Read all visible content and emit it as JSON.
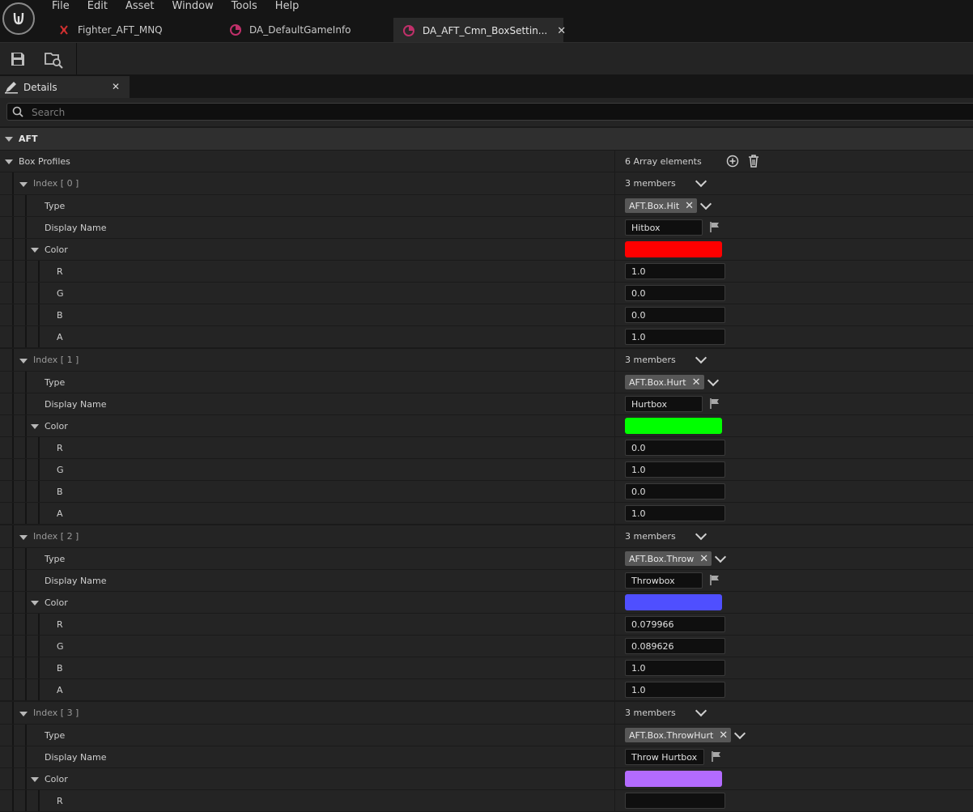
{
  "menu": [
    "File",
    "Edit",
    "Asset",
    "Window",
    "Tools",
    "Help"
  ],
  "tabs": [
    {
      "label": "Fighter_AFT_MNQ"
    },
    {
      "label": "DA_DefaultGameInfo"
    },
    {
      "label": "DA_AFT_Cmn_BoxSettin..."
    }
  ],
  "panel": {
    "title": "Details"
  },
  "search": {
    "placeholder": "Search"
  },
  "category": {
    "label": "AFT"
  },
  "box_profiles": {
    "label": "Box Profiles",
    "count_label": "6 Array elements"
  },
  "labels": {
    "members": "3 members",
    "type": "Type",
    "display_name": "Display Name",
    "color": "Color",
    "r": "R",
    "g": "G",
    "b": "B",
    "a": "A"
  },
  "elements": [
    {
      "index_label": "Index [ 0 ]",
      "type": "AFT.Box.Hit",
      "display_name": "Hitbox",
      "color_hex": "#ff0000",
      "r": "1.0",
      "g": "0.0",
      "b": "0.0",
      "a": "1.0"
    },
    {
      "index_label": "Index [ 1 ]",
      "type": "AFT.Box.Hurt",
      "display_name": "Hurtbox",
      "color_hex": "#00ff00",
      "r": "0.0",
      "g": "1.0",
      "b": "0.0",
      "a": "1.0"
    },
    {
      "index_label": "Index [ 2 ]",
      "type": "AFT.Box.Throw",
      "display_name": "Throwbox",
      "color_hex": "#4f4fff",
      "r": "0.079966",
      "g": "0.089626",
      "b": "1.0",
      "a": "1.0"
    },
    {
      "index_label": "Index [ 3 ]",
      "type": "AFT.Box.ThrowHurt",
      "display_name": "Throw Hurtbox",
      "color_hex": "#b36bff",
      "r": "",
      "g": "",
      "b": "",
      "a": ""
    }
  ]
}
